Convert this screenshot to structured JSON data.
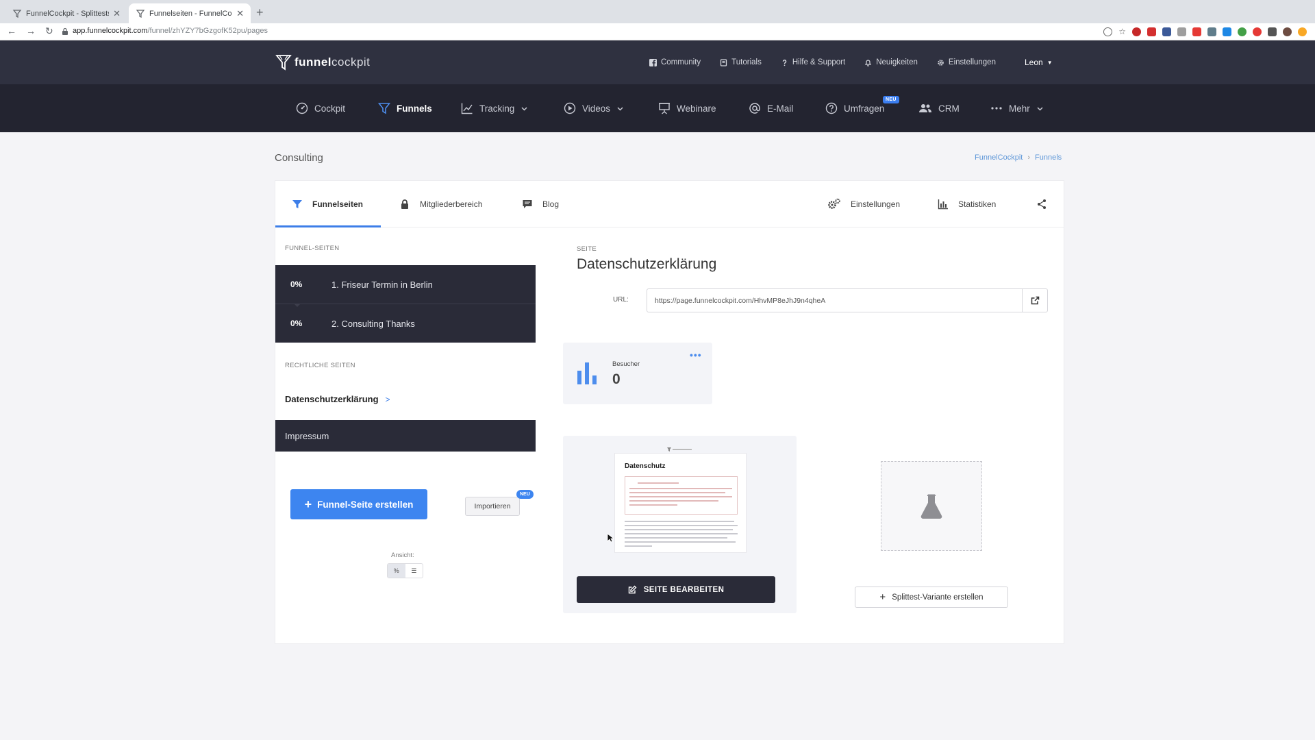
{
  "browser": {
    "tabs": [
      {
        "title": "FunnelCockpit - Splittests, Ma",
        "active": false
      },
      {
        "title": "Funnelseiten - FunnelCockpit",
        "active": true
      }
    ],
    "url_host": "app.funnelcockpit.com",
    "url_path": "/funnel/zhYZY7bGzgofK52pu/pages"
  },
  "header": {
    "logo_bold": "funnel",
    "logo_light": "cockpit",
    "links": [
      {
        "label": "Community",
        "icon": "facebook-icon"
      },
      {
        "label": "Tutorials",
        "icon": "book-icon"
      },
      {
        "label": "Hilfe & Support",
        "icon": "question-icon"
      },
      {
        "label": "Neuigkeiten",
        "icon": "bell-icon"
      },
      {
        "label": "Einstellungen",
        "icon": "gear-icon"
      }
    ],
    "user": "Leon"
  },
  "mainnav": {
    "items": [
      {
        "label": "Cockpit",
        "icon": "gauge-icon"
      },
      {
        "label": "Funnels",
        "icon": "funnel-icon",
        "active": true
      },
      {
        "label": "Tracking",
        "icon": "line-chart-icon",
        "dropdown": true
      },
      {
        "label": "Videos",
        "icon": "play-icon",
        "dropdown": true
      },
      {
        "label": "Webinare",
        "icon": "presentation-icon"
      },
      {
        "label": "E-Mail",
        "icon": "at-icon"
      },
      {
        "label": "Umfragen",
        "icon": "question-circle-icon",
        "badge": "NEU"
      },
      {
        "label": "CRM",
        "icon": "users-icon"
      },
      {
        "label": "Mehr",
        "icon": "dots-icon",
        "dropdown": true
      }
    ]
  },
  "page": {
    "title": "Consulting",
    "breadcrumb": [
      "FunnelCockpit",
      "Funnels"
    ]
  },
  "tabs": {
    "left": [
      {
        "label": "Funnelseiten",
        "icon": "funnel-icon",
        "active": true
      },
      {
        "label": "Mitgliederbereich",
        "icon": "lock-icon"
      },
      {
        "label": "Blog",
        "icon": "comment-icon"
      }
    ],
    "right": [
      {
        "label": "Einstellungen",
        "icon": "gears-icon"
      },
      {
        "label": "Statistiken",
        "icon": "bar-chart-icon"
      }
    ],
    "share_icon": "share-icon"
  },
  "sidebar": {
    "funnel_pages_label": "FUNNEL-SEITEN",
    "funnel_pages": [
      {
        "pct": "0%",
        "name": "1. Friseur Termin in Berlin"
      },
      {
        "pct": "0%",
        "name": "2. Consulting Thanks"
      }
    ],
    "legal_label": "RECHTLICHE SEITEN",
    "legal_pages": [
      {
        "name": "Datenschutzerklärung",
        "active": true,
        "arrow": ">"
      },
      {
        "name": "Impressum",
        "active": false
      }
    ],
    "create_button": "Funnel-Seite erstellen",
    "import_button": "Importieren",
    "import_badge": "NEU",
    "view_label": "Ansicht:",
    "view_options": [
      "percent",
      "list"
    ],
    "view_active": "percent"
  },
  "detail": {
    "section_label": "SEITE",
    "page_name": "Datenschutzerklärung",
    "url_label": "URL:",
    "url_value": "https://page.funnelcockpit.com/HhvMP8eJhJ9n4qheA",
    "visitors_label": "Besucher",
    "visitors_value": "0",
    "preview_heading": "Datenschutz",
    "edit_button": "SEITE BEARBEITEN",
    "split_button": "Splittest-Variante erstellen"
  },
  "colors": {
    "accent": "#3d85f0",
    "dark_nav": "#232430",
    "header": "#2f3140",
    "dark_row": "#2a2b38"
  }
}
